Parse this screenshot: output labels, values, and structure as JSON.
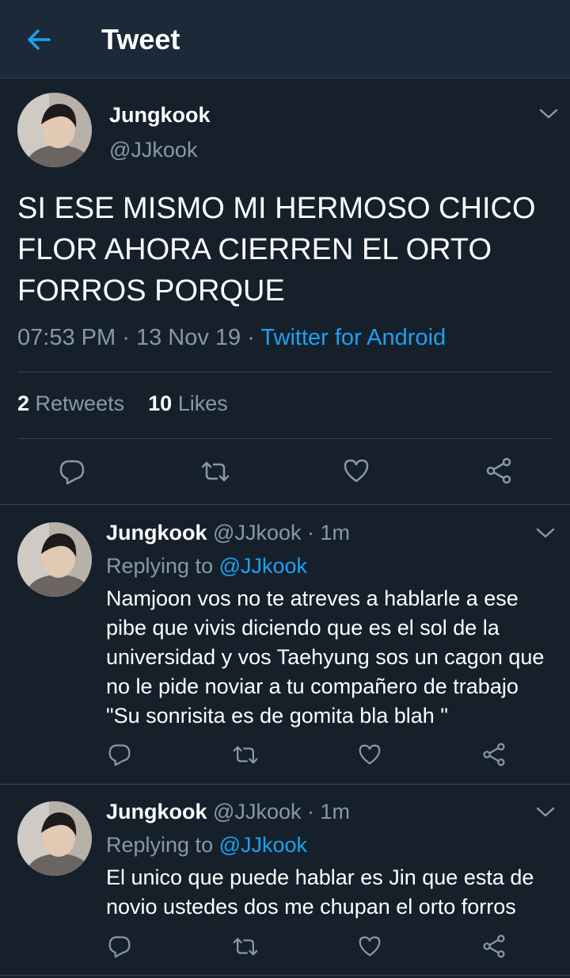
{
  "header": {
    "title": "Tweet",
    "back_icon": "arrow-left-icon",
    "accent": "#1da1f2"
  },
  "main_tweet": {
    "author_name": "Jungkook",
    "author_handle": "@JJkook",
    "text": "SI ESE MISMO MI HERMOSO CHICO FLOR AHORA CIERREN EL ORTO FORROS PORQUE",
    "time": "07:53 PM",
    "date": "13 Nov 19",
    "sep": "·",
    "source": "Twitter for Android",
    "retweets_count": "2",
    "retweets_label": "Retweets",
    "likes_count": "10",
    "likes_label": "Likes"
  },
  "replies": [
    {
      "author_name": "Jungkook",
      "author_handle": "@JJkook",
      "time_ago": "· 1m",
      "replying_label": "Replying to",
      "replying_to": "@JJkook",
      "text": "Namjoon vos no te atreves a hablarle a ese pibe que vivis diciendo que es el sol de la universidad y vos Taehyung sos un cagon que no le pide noviar a tu compañero de trabajo \"Su sonrisita es de gomita bla blah \""
    },
    {
      "author_name": "Jungkook",
      "author_handle": "@JJkook",
      "time_ago": "· 1m",
      "replying_label": "Replying to",
      "replying_to": "@JJkook",
      "text": "El unico que puede hablar es Jin que esta de novio ustedes dos me chupan el orto forros"
    }
  ],
  "icons": [
    "reply-icon",
    "retweet-icon",
    "like-icon",
    "share-icon",
    "chevron-down-icon"
  ]
}
